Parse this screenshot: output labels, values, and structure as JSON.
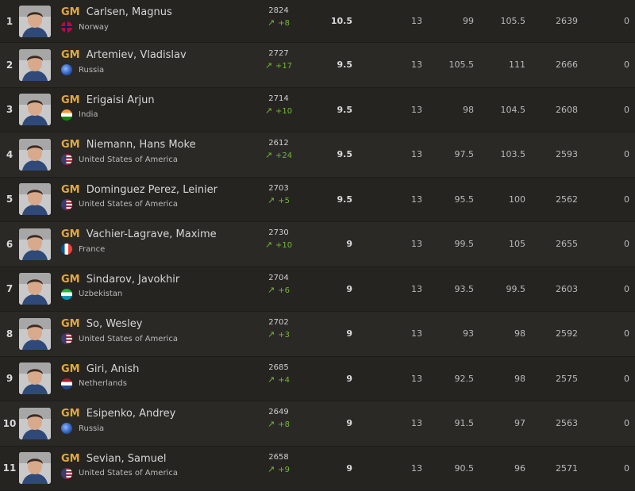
{
  "rows": [
    {
      "rank": "1",
      "title": "GM",
      "name": "Carlsen, Magnus",
      "country": "Norway",
      "flag": "no",
      "rating": "2824",
      "delta": "+8",
      "points": "10.5",
      "games": "13",
      "tb1": "99",
      "tb2": "105.5",
      "perf": "2639",
      "last": "0"
    },
    {
      "rank": "2",
      "title": "GM",
      "name": "Artemiev, Vladislav",
      "country": "Russia",
      "flag": "globe",
      "rating": "2727",
      "delta": "+17",
      "points": "9.5",
      "games": "13",
      "tb1": "105.5",
      "tb2": "111",
      "perf": "2666",
      "last": "0"
    },
    {
      "rank": "3",
      "title": "GM",
      "name": "Erigaisi Arjun",
      "country": "India",
      "flag": "in",
      "rating": "2714",
      "delta": "+10",
      "points": "9.5",
      "games": "13",
      "tb1": "98",
      "tb2": "104.5",
      "perf": "2608",
      "last": "0"
    },
    {
      "rank": "4",
      "title": "GM",
      "name": "Niemann, Hans Moke",
      "country": "United States of America",
      "flag": "us",
      "rating": "2612",
      "delta": "+24",
      "points": "9.5",
      "games": "13",
      "tb1": "97.5",
      "tb2": "103.5",
      "perf": "2593",
      "last": "0"
    },
    {
      "rank": "5",
      "title": "GM",
      "name": "Dominguez Perez, Leinier",
      "country": "United States of America",
      "flag": "us",
      "rating": "2703",
      "delta": "+5",
      "points": "9.5",
      "games": "13",
      "tb1": "95.5",
      "tb2": "100",
      "perf": "2562",
      "last": "0"
    },
    {
      "rank": "6",
      "title": "GM",
      "name": "Vachier-Lagrave, Maxime",
      "country": "France",
      "flag": "fr",
      "rating": "2730",
      "delta": "+10",
      "points": "9",
      "games": "13",
      "tb1": "99.5",
      "tb2": "105",
      "perf": "2655",
      "last": "0"
    },
    {
      "rank": "7",
      "title": "GM",
      "name": "Sindarov, Javokhir",
      "country": "Uzbekistan",
      "flag": "uz",
      "rating": "2704",
      "delta": "+6",
      "points": "9",
      "games": "13",
      "tb1": "93.5",
      "tb2": "99.5",
      "perf": "2603",
      "last": "0"
    },
    {
      "rank": "8",
      "title": "GM",
      "name": "So, Wesley",
      "country": "United States of America",
      "flag": "us",
      "rating": "2702",
      "delta": "+3",
      "points": "9",
      "games": "13",
      "tb1": "93",
      "tb2": "98",
      "perf": "2592",
      "last": "0"
    },
    {
      "rank": "9",
      "title": "GM",
      "name": "Giri, Anish",
      "country": "Netherlands",
      "flag": "nl",
      "rating": "2685",
      "delta": "+4",
      "points": "9",
      "games": "13",
      "tb1": "92.5",
      "tb2": "98",
      "perf": "2575",
      "last": "0"
    },
    {
      "rank": "10",
      "title": "GM",
      "name": "Esipenko, Andrey",
      "country": "Russia",
      "flag": "globe",
      "rating": "2649",
      "delta": "+8",
      "points": "9",
      "games": "13",
      "tb1": "91.5",
      "tb2": "97",
      "perf": "2563",
      "last": "0"
    },
    {
      "rank": "11",
      "title": "GM",
      "name": "Sevian, Samuel",
      "country": "United States of America",
      "flag": "us",
      "rating": "2658",
      "delta": "+9",
      "points": "9",
      "games": "13",
      "tb1": "90.5",
      "tb2": "96",
      "perf": "2571",
      "last": "0"
    }
  ],
  "colors": {
    "title": "#e2a93e",
    "positive_delta": "#71b838",
    "row_odd": "#262421",
    "row_even": "#2b2926"
  },
  "icons": {
    "delta": "rating-up-arrow-icon",
    "avatar": "player-photo",
    "flag": "country-flag-icon"
  }
}
